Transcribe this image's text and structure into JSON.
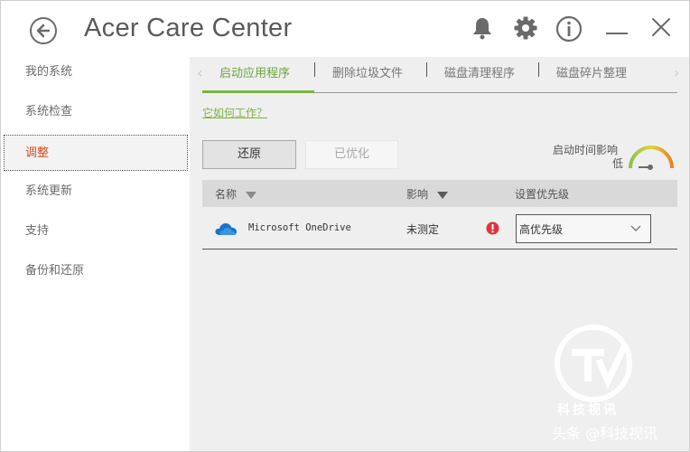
{
  "app": {
    "title": "Acer Care Center"
  },
  "sidebar": {
    "items": [
      {
        "label": "我的系统"
      },
      {
        "label": "系统检查"
      },
      {
        "label": "调整"
      },
      {
        "label": "系统更新"
      },
      {
        "label": "支持"
      },
      {
        "label": "备份和还原"
      }
    ],
    "active_index": 2
  },
  "tabs": [
    {
      "label": "启动应用程序"
    },
    {
      "label": "删除垃圾文件"
    },
    {
      "label": "磁盘清理程序"
    },
    {
      "label": "磁盘碎片整理"
    }
  ],
  "links": {
    "how_it_works": "它如何工作？"
  },
  "buttons": {
    "restore": "还原",
    "optimized": "已优化"
  },
  "impact_meter": {
    "label": "启动时间影响",
    "level": "低"
  },
  "table": {
    "headers": {
      "name": "名称",
      "impact": "影响",
      "priority": "设置优先级"
    },
    "rows": [
      {
        "app": "Microsoft OneDrive",
        "impact": "未测定",
        "priority": "高优先级"
      }
    ]
  },
  "watermark": {
    "brand": "科技视讯",
    "source": "头条 @科技视讯"
  },
  "colors": {
    "accent_green": "#7cb342",
    "active_nav": "#d94a1e",
    "warning_red": "#d9363e",
    "onedrive_blue": "#1a73c9"
  }
}
